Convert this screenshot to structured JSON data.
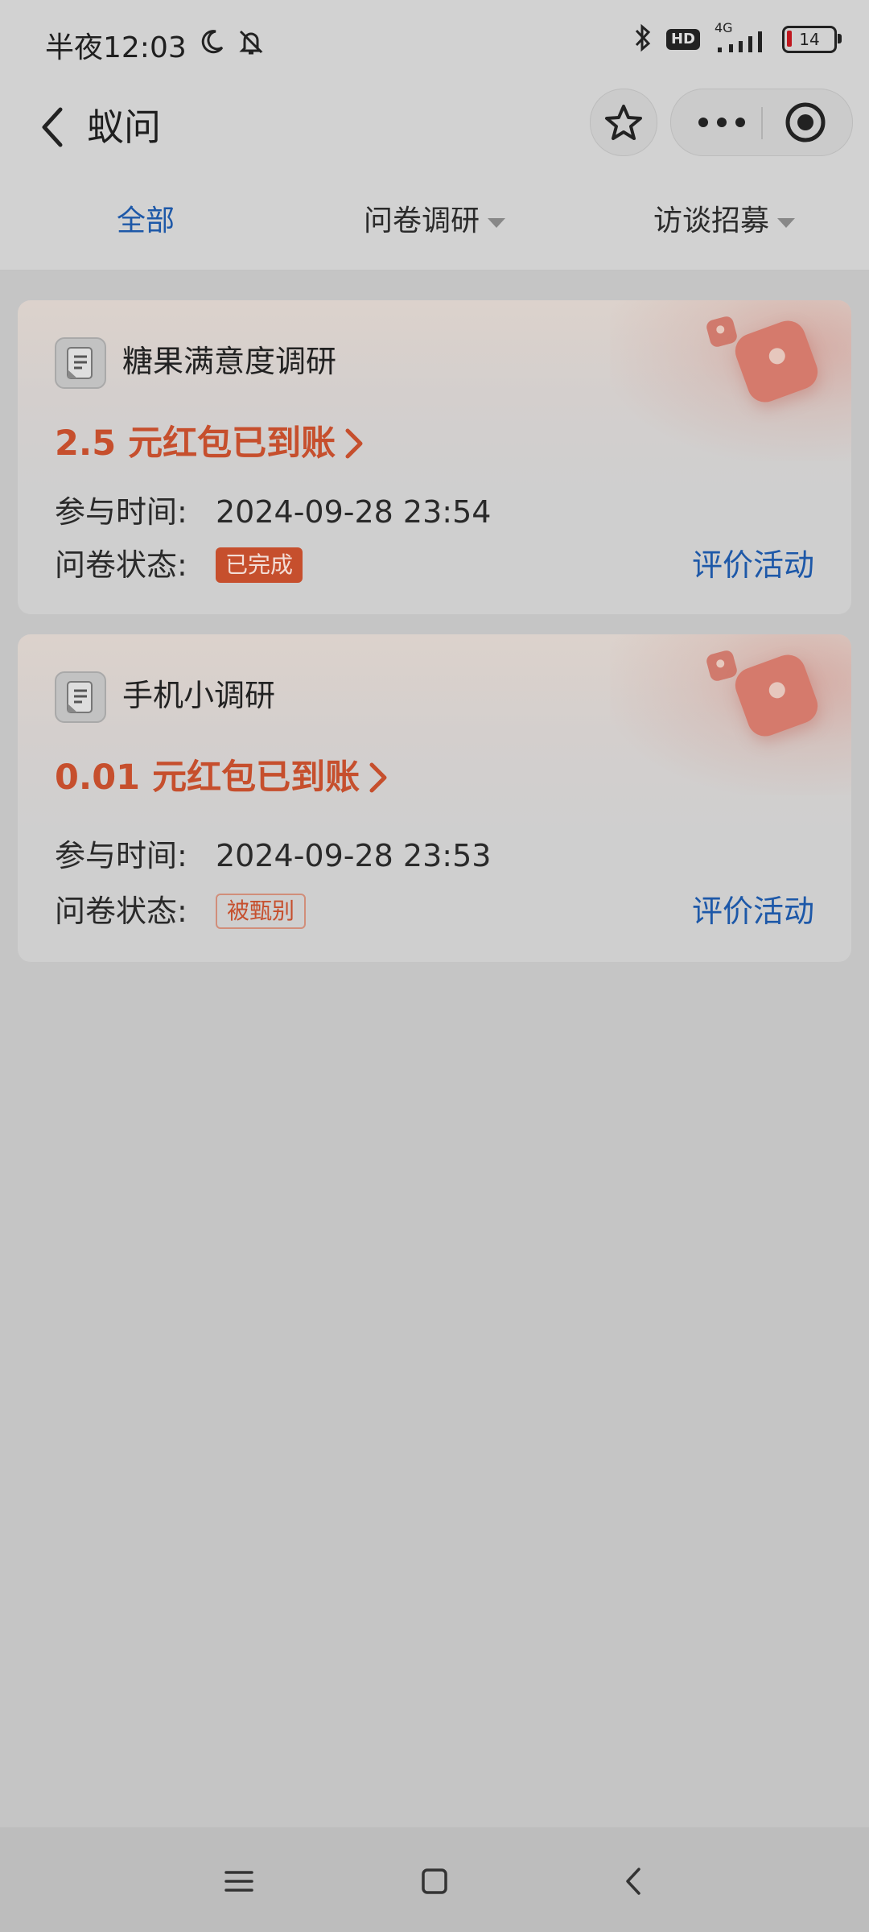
{
  "status_bar": {
    "time": "半夜12:03",
    "network": "4G",
    "hd": "HD",
    "battery": "14"
  },
  "header": {
    "title": "蚁问"
  },
  "tabs": [
    {
      "label": "全部",
      "active": true
    },
    {
      "label": "问卷调研",
      "active": false
    },
    {
      "label": "访谈招募",
      "active": false
    }
  ],
  "cards": [
    {
      "title": "糖果满意度调研",
      "reward": "2.5 元红包已到账",
      "time_label": "参与时间:",
      "time_value": "2024-09-28 23:54",
      "status_label": "问卷状态:",
      "status_value": "已完成",
      "action": "评价活动"
    },
    {
      "title": "手机小调研",
      "reward": "0.01 元红包已到账",
      "time_label": "参与时间:",
      "time_value": "2024-09-28 23:53",
      "status_label": "问卷状态:",
      "status_value": "被甄别",
      "action": "评价活动"
    }
  ],
  "colors": {
    "accent_blue": "#1d58a8",
    "reward_red": "#c64f2d"
  }
}
